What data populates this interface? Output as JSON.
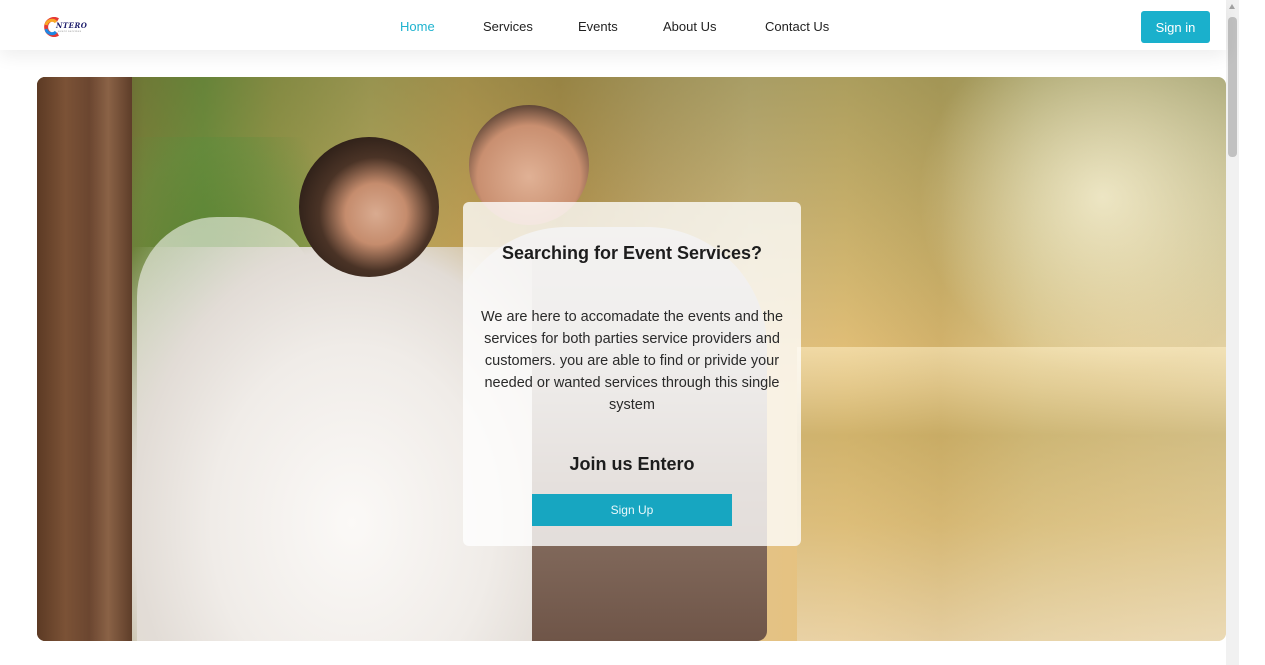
{
  "brand": {
    "logo_text": "NTERO",
    "logo_subtext": "event services"
  },
  "nav": {
    "items": [
      {
        "label": "Home",
        "active": true
      },
      {
        "label": "Services",
        "active": false
      },
      {
        "label": "Events",
        "active": false
      },
      {
        "label": "About Us",
        "active": false
      },
      {
        "label": "Contact Us",
        "active": false
      }
    ],
    "signin_label": "Sign in"
  },
  "hero": {
    "title": "Searching for Event Services?",
    "body": "We are here to accomadate the events and the services for both parties service providers and customers. you are able to find or privide your needed or wanted services through this single system",
    "join_label": "Join us Entero",
    "signup_label": "Sign Up"
  },
  "colors": {
    "accent": "#1ab0cc",
    "nav_active": "#1fb3cf",
    "logo_colors": [
      "#e53935",
      "#f9a825",
      "#1e88e5",
      "#1c1c6b"
    ]
  }
}
